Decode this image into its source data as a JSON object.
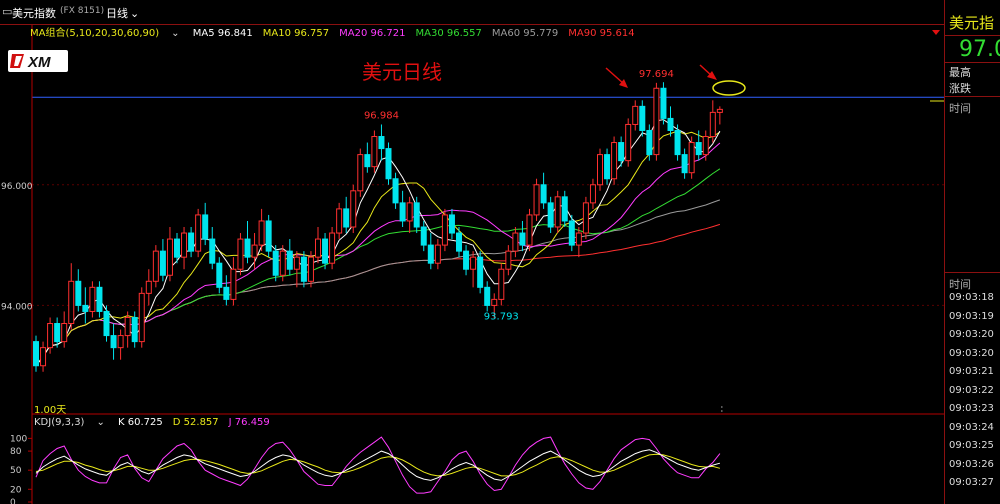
{
  "window": {
    "icon": "minimize-icon",
    "symbol_title": "美元指数",
    "symbol_code": "(FX 8151)",
    "period": "日线",
    "period_caret": "⌄"
  },
  "logo": {
    "text": "XM",
    "icon": "xm-logo"
  },
  "annotation_title": "美元日线",
  "ma_bar": {
    "group_label": "MA组合(5,10,20,30,60,90)",
    "caret": "⌄",
    "items": [
      {
        "label": "MA5 96.841",
        "color": "#ffffff"
      },
      {
        "label": "MA10 96.757",
        "color": "#e8e81a"
      },
      {
        "label": "MA20 96.721",
        "color": "#ff3cff"
      },
      {
        "label": "MA30 96.557",
        "color": "#33dd33"
      },
      {
        "label": "MA60 95.779",
        "color": "#9a9a9a"
      },
      {
        "label": "MA90 95.614",
        "color": "#ff3030"
      }
    ]
  },
  "kdj_bar": {
    "label": "KDJ(9,3,3)",
    "caret": "⌄",
    "items": [
      {
        "label": "K 60.725",
        "color": "#ffffff"
      },
      {
        "label": "D 52.857",
        "color": "#e8e81a"
      },
      {
        "label": "J 76.459",
        "color": "#ff3cff"
      }
    ]
  },
  "volume_label": "1.00天",
  "side_panel": {
    "title": "美元指",
    "price": "97.0",
    "high_label": "最高",
    "change_label": "涨跌",
    "time_label_1": "时间",
    "time_label_2": "时间",
    "times": [
      "09:03:18",
      "09:03:19",
      "09:03:20",
      "09:03:20",
      "09:03:21",
      "09:03:22",
      "09:03:23",
      "09:03:24",
      "09:03:25",
      "09:03:26",
      "09:03:27"
    ]
  },
  "colors": {
    "up": "#ff3030",
    "down": "#00e5ee",
    "hline": "#3060ff",
    "annotation": "#e01010",
    "ellipse": "#e8e81a",
    "axis": "#b40000"
  },
  "chart_data": {
    "type": "candlestick",
    "y_ticks": [
      "96.000",
      "94.000"
    ],
    "ylim": [
      92.2,
      98.4
    ],
    "horizontal_line": 97.45,
    "annotations": [
      {
        "text": "96.984",
        "kind": "high",
        "bar": 49
      },
      {
        "text": "97.694",
        "kind": "high",
        "bar": 88
      },
      {
        "text": "93.793",
        "kind": "low",
        "bar": 66
      }
    ],
    "candles": [
      [
        93.4,
        93.5,
        92.9,
        93.0
      ],
      [
        93.0,
        93.4,
        92.9,
        93.3
      ],
      [
        93.3,
        93.8,
        93.2,
        93.7
      ],
      [
        93.7,
        93.8,
        93.3,
        93.4
      ],
      [
        93.4,
        93.9,
        93.3,
        93.7
      ],
      [
        93.7,
        94.7,
        93.6,
        94.4
      ],
      [
        94.4,
        94.6,
        93.9,
        94.0
      ],
      [
        94.0,
        94.3,
        93.7,
        93.9
      ],
      [
        93.9,
        94.4,
        93.8,
        94.3
      ],
      [
        94.3,
        94.4,
        93.8,
        93.9
      ],
      [
        93.9,
        94.0,
        93.4,
        93.5
      ],
      [
        93.5,
        93.7,
        93.1,
        93.3
      ],
      [
        93.3,
        93.6,
        93.1,
        93.5
      ],
      [
        93.5,
        93.9,
        93.3,
        93.8
      ],
      [
        93.8,
        93.9,
        93.3,
        93.4
      ],
      [
        93.4,
        94.3,
        93.3,
        94.2
      ],
      [
        94.2,
        94.6,
        94.0,
        94.4
      ],
      [
        94.4,
        95.0,
        94.3,
        94.9
      ],
      [
        94.9,
        95.1,
        94.4,
        94.5
      ],
      [
        94.5,
        95.3,
        94.4,
        95.1
      ],
      [
        95.1,
        95.2,
        94.7,
        94.8
      ],
      [
        94.8,
        95.3,
        94.6,
        95.2
      ],
      [
        95.2,
        95.3,
        94.8,
        94.9
      ],
      [
        94.9,
        95.6,
        94.8,
        95.5
      ],
      [
        95.5,
        95.7,
        95.0,
        95.1
      ],
      [
        95.1,
        95.3,
        94.6,
        94.7
      ],
      [
        94.7,
        94.8,
        94.2,
        94.3
      ],
      [
        94.3,
        94.5,
        94.0,
        94.1
      ],
      [
        94.1,
        94.8,
        94.0,
        94.6
      ],
      [
        94.6,
        95.2,
        94.5,
        95.1
      ],
      [
        95.1,
        95.4,
        94.7,
        94.8
      ],
      [
        94.8,
        95.2,
        94.6,
        95.0
      ],
      [
        95.0,
        95.6,
        94.9,
        95.4
      ],
      [
        95.4,
        95.5,
        94.8,
        94.9
      ],
      [
        94.9,
        95.0,
        94.4,
        94.5
      ],
      [
        94.5,
        95.0,
        94.4,
        94.9
      ],
      [
        94.9,
        95.1,
        94.5,
        94.6
      ],
      [
        94.6,
        94.9,
        94.3,
        94.8
      ],
      [
        94.8,
        94.9,
        94.3,
        94.4
      ],
      [
        94.4,
        94.9,
        94.3,
        94.8
      ],
      [
        94.8,
        95.3,
        94.7,
        95.1
      ],
      [
        95.1,
        95.2,
        94.6,
        94.7
      ],
      [
        94.7,
        95.3,
        94.6,
        95.2
      ],
      [
        95.2,
        95.7,
        95.1,
        95.6
      ],
      [
        95.6,
        95.8,
        95.2,
        95.3
      ],
      [
        95.3,
        96.0,
        95.2,
        95.9
      ],
      [
        95.9,
        96.6,
        95.8,
        96.5
      ],
      [
        96.5,
        96.7,
        96.2,
        96.3
      ],
      [
        96.3,
        96.9,
        96.2,
        96.8
      ],
      [
        96.8,
        97.0,
        96.4,
        96.6
      ],
      [
        96.6,
        96.7,
        96.0,
        96.1
      ],
      [
        96.1,
        96.2,
        95.6,
        95.7
      ],
      [
        95.7,
        95.9,
        95.3,
        95.4
      ],
      [
        95.4,
        95.8,
        95.2,
        95.7
      ],
      [
        95.7,
        95.8,
        95.2,
        95.3
      ],
      [
        95.3,
        95.4,
        94.9,
        95.0
      ],
      [
        95.0,
        95.2,
        94.6,
        94.7
      ],
      [
        94.7,
        95.1,
        94.6,
        95.0
      ],
      [
        95.0,
        95.6,
        94.9,
        95.5
      ],
      [
        95.5,
        95.6,
        95.1,
        95.2
      ],
      [
        95.2,
        95.3,
        94.8,
        94.9
      ],
      [
        94.9,
        95.0,
        94.5,
        94.6
      ],
      [
        94.6,
        94.9,
        94.3,
        94.8
      ],
      [
        94.8,
        94.9,
        94.2,
        94.3
      ],
      [
        94.3,
        94.4,
        93.9,
        94.0
      ],
      [
        94.0,
        94.2,
        93.79,
        94.1
      ],
      [
        94.1,
        94.7,
        94.0,
        94.6
      ],
      [
        94.6,
        95.0,
        94.5,
        94.9
      ],
      [
        94.9,
        95.3,
        94.8,
        95.2
      ],
      [
        95.2,
        95.4,
        94.9,
        95.0
      ],
      [
        95.0,
        95.6,
        94.9,
        95.5
      ],
      [
        95.5,
        96.1,
        95.4,
        96.0
      ],
      [
        96.0,
        96.2,
        95.6,
        95.7
      ],
      [
        95.7,
        95.8,
        95.2,
        95.3
      ],
      [
        95.3,
        95.9,
        95.2,
        95.8
      ],
      [
        95.8,
        95.9,
        95.3,
        95.4
      ],
      [
        95.4,
        95.5,
        94.9,
        95.0
      ],
      [
        95.0,
        95.3,
        94.8,
        95.2
      ],
      [
        95.2,
        95.8,
        95.1,
        95.7
      ],
      [
        95.7,
        96.1,
        95.6,
        96.0
      ],
      [
        96.0,
        96.6,
        95.9,
        96.5
      ],
      [
        96.5,
        96.6,
        96.0,
        96.1
      ],
      [
        96.1,
        96.8,
        96.0,
        96.7
      ],
      [
        96.7,
        96.8,
        96.3,
        96.4
      ],
      [
        96.4,
        97.1,
        96.3,
        97.0
      ],
      [
        97.0,
        97.4,
        96.9,
        97.3
      ],
      [
        97.3,
        97.4,
        96.8,
        96.9
      ],
      [
        96.9,
        97.0,
        96.4,
        96.5
      ],
      [
        96.5,
        97.69,
        96.4,
        97.6
      ],
      [
        97.6,
        97.7,
        97.0,
        97.1
      ],
      [
        97.1,
        97.3,
        96.8,
        96.9
      ],
      [
        96.9,
        97.0,
        96.4,
        96.5
      ],
      [
        96.5,
        96.6,
        96.1,
        96.2
      ],
      [
        96.2,
        96.8,
        96.1,
        96.7
      ],
      [
        96.7,
        96.9,
        96.4,
        96.5
      ],
      [
        96.5,
        96.9,
        96.4,
        96.8
      ],
      [
        96.8,
        97.4,
        96.7,
        97.2
      ],
      [
        97.2,
        97.3,
        97.0,
        97.25
      ]
    ],
    "kdj": {
      "y_ticks": [
        "100",
        "80",
        "50",
        "20",
        "0"
      ],
      "ylim": [
        0,
        110
      ],
      "K": [
        45,
        55,
        62,
        68,
        72,
        65,
        58,
        52,
        48,
        44,
        42,
        50,
        58,
        62,
        55,
        48,
        44,
        50,
        58,
        64,
        70,
        74,
        72,
        66,
        60,
        56,
        52,
        48,
        44,
        40,
        42,
        48,
        56,
        64,
        70,
        74,
        72,
        66,
        58,
        52,
        46,
        42,
        40,
        44,
        50,
        56,
        62,
        68,
        74,
        80,
        76,
        68,
        58,
        48,
        40,
        36,
        34,
        38,
        44,
        52,
        58,
        62,
        58,
        50,
        42,
        36,
        34,
        40,
        48,
        56,
        64,
        70,
        76,
        80,
        74,
        66,
        58,
        50,
        44,
        40,
        42,
        48,
        56,
        64,
        70,
        76,
        80,
        82,
        78,
        72,
        66,
        60,
        56,
        52,
        50,
        54,
        58,
        61
      ],
      "D": [
        48,
        50,
        55,
        60,
        64,
        64,
        62,
        58,
        55,
        51,
        48,
        49,
        52,
        56,
        56,
        53,
        50,
        50,
        53,
        57,
        61,
        65,
        67,
        67,
        65,
        62,
        59,
        55,
        51,
        47,
        45,
        46,
        49,
        54,
        59,
        64,
        67,
        66,
        63,
        59,
        55,
        50,
        47,
        46,
        47,
        50,
        54,
        59,
        64,
        69,
        71,
        70,
        66,
        60,
        53,
        47,
        43,
        41,
        42,
        45,
        49,
        53,
        55,
        53,
        49,
        45,
        41,
        41,
        43,
        47,
        53,
        58,
        64,
        69,
        71,
        69,
        65,
        60,
        55,
        50,
        47,
        47,
        50,
        55,
        60,
        65,
        70,
        74,
        75,
        74,
        71,
        67,
        63,
        59,
        56,
        55,
        56,
        53
      ],
      "J": [
        39,
        65,
        76,
        84,
        88,
        67,
        50,
        40,
        34,
        30,
        30,
        52,
        70,
        74,
        53,
        38,
        32,
        50,
        68,
        78,
        88,
        92,
        82,
        64,
        50,
        44,
        38,
        34,
        30,
        26,
        36,
        52,
        70,
        84,
        92,
        94,
        82,
        66,
        48,
        38,
        28,
        26,
        26,
        40,
        56,
        68,
        78,
        86,
        94,
        102,
        86,
        64,
        42,
        24,
        14,
        14,
        16,
        32,
        48,
        66,
        76,
        80,
        64,
        44,
        28,
        18,
        20,
        38,
        58,
        74,
        86,
        94,
        100,
        102,
        80,
        60,
        44,
        30,
        22,
        20,
        32,
        50,
        68,
        82,
        90,
        98,
        100,
        98,
        84,
        68,
        56,
        46,
        42,
        38,
        38,
        52,
        62,
        76
      ]
    }
  }
}
